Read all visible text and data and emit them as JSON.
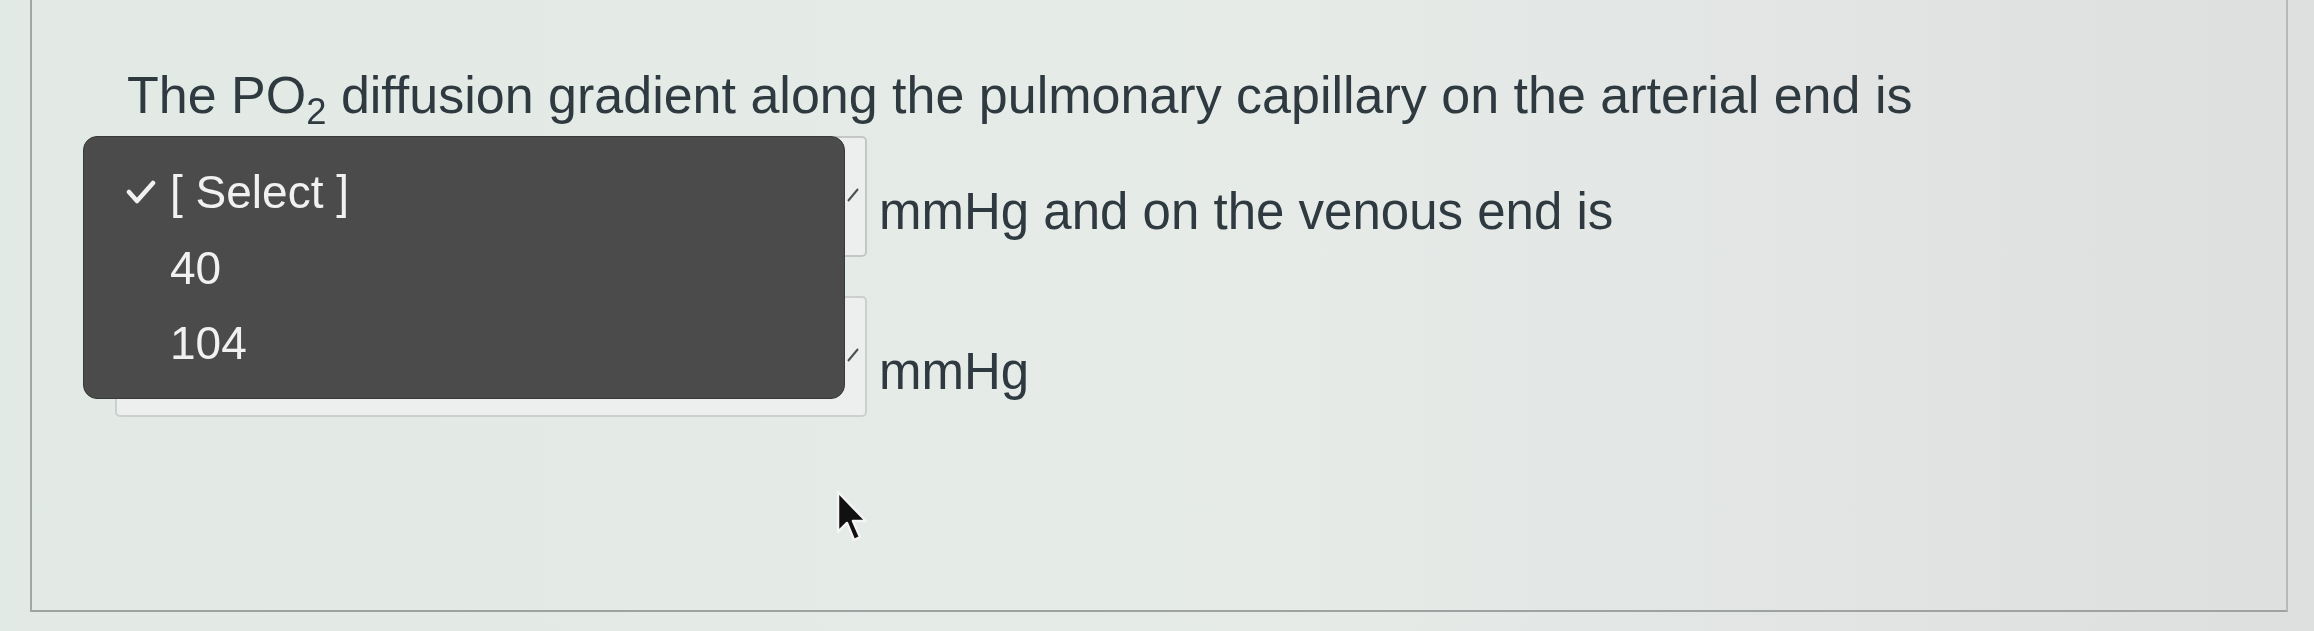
{
  "question": {
    "text": "The PO$_{2}$ diffusion gradient along the pulmonary capillary on the arterial end is"
  },
  "answer_rows": [
    {
      "dropdown": {
        "expanded": true,
        "options": [
          {
            "label": "[ Select ]",
            "selected": true
          },
          {
            "label": "40",
            "selected": false
          },
          {
            "label": "104",
            "selected": false
          }
        ]
      },
      "after_text": "mmHg and on the venous end is"
    },
    {
      "dropdown": {
        "expanded": false
      },
      "after_text": "mmHg"
    }
  ]
}
